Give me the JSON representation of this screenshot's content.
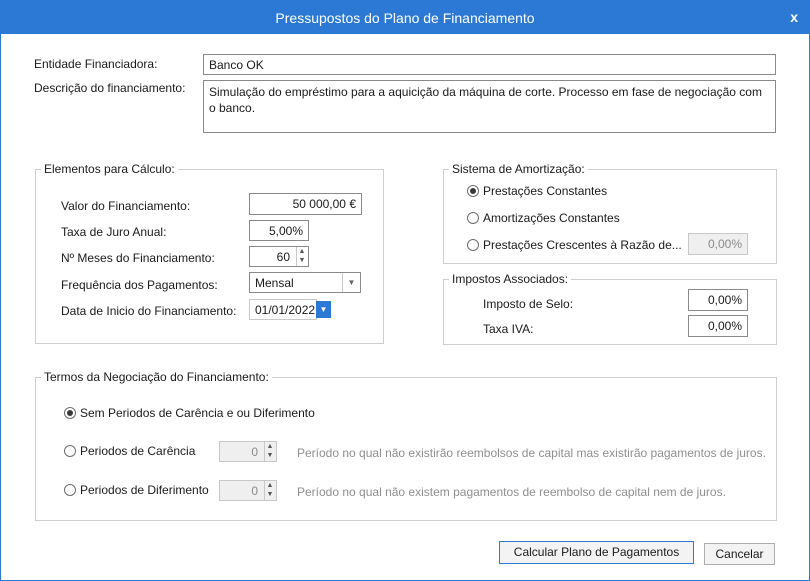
{
  "window": {
    "title": "Pressupostos do Plano de Financiamento",
    "close": "x"
  },
  "header": {
    "entidade_label": "Entidade Financiadora:",
    "entidade_value": "Banco OK",
    "descricao_label": "Descrição do financiamento:",
    "descricao_value": "Simulação do empréstimo para a aquicição da máquina de corte. Processo em fase de negociação com o banco."
  },
  "calculo": {
    "title": "Elementos para Cálculo:",
    "valor_label": "Valor do Financiamento:",
    "valor_value": "50 000,00 €",
    "taxa_label": "Taxa de Juro Anual:",
    "taxa_value": "5,00%",
    "meses_label": "Nº Meses do Financiamento:",
    "meses_value": "60",
    "frequencia_label": "Frequência dos Pagamentos:",
    "frequencia_value": "Mensal",
    "data_label": "Data de Inicio do Financiamento:",
    "data_value": "01/01/2022"
  },
  "amortizacao": {
    "title": "Sistema de Amortização:",
    "opt1": "Prestações Constantes",
    "opt2": "Amortizações Constantes",
    "opt3": "Prestações Crescentes à Razão de...",
    "razao_value": "0,00%"
  },
  "impostos": {
    "title": "Impostos Associados:",
    "selo_label": "Imposto de Selo:",
    "selo_value": "0,00%",
    "iva_label": "Taxa IVA:",
    "iva_value": "0,00%"
  },
  "termos": {
    "title": "Termos da Negociação do Financiamento:",
    "opt1": "Sem Periodos de Carência e ou Diferimento",
    "opt2": "Periodos de Carência",
    "carencia_value": "0",
    "carencia_hint": "Período no qual não existirão reembolsos de capital mas existirão pagamentos de juros.",
    "opt3": "Periodos de Diferimento",
    "diferimento_value": "0",
    "diferimento_hint": "Período no qual não existem pagamentos de reembolso de capital nem de juros."
  },
  "buttons": {
    "calcular": "Calcular Plano de Pagamentos",
    "cancelar": "Cancelar"
  },
  "colors": {
    "accent": "#2b79d4"
  }
}
